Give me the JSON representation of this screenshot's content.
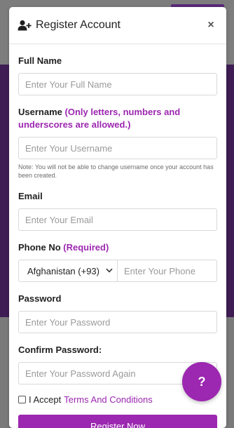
{
  "modal": {
    "title": "Register Account",
    "title_icon": "user-plus-icon",
    "close_label": "×"
  },
  "form": {
    "full_name": {
      "label": "Full Name",
      "placeholder": "Enter Your Full Name"
    },
    "username": {
      "label": "Username",
      "rule_note": "(Only letters, numbers and underscores are allowed.)",
      "placeholder": "Enter Your Username",
      "hint": "Note: You will not be able to change username once your account has been created."
    },
    "email": {
      "label": "Email",
      "placeholder": "Enter Your Email"
    },
    "phone": {
      "label": "Phone No",
      "required_note": "(Required)",
      "country_selected": "Afghanistan (+93)",
      "placeholder": "Enter Your Phone"
    },
    "password": {
      "label": "Password",
      "placeholder": "Enter Your Password"
    },
    "confirm_password": {
      "label": "Confirm Password:",
      "placeholder": "Enter Your Password Again"
    },
    "terms": {
      "prefix": "I Accept",
      "link_text": "Terms And Conditions",
      "checked": false
    },
    "submit_label": "Register Now"
  },
  "help_button": {
    "label": "?",
    "icon": "question-icon"
  },
  "colors": {
    "accent": "#9c27b0",
    "backdrop_band": "#3f1d54",
    "backdrop_gray": "#7a7a7a"
  }
}
